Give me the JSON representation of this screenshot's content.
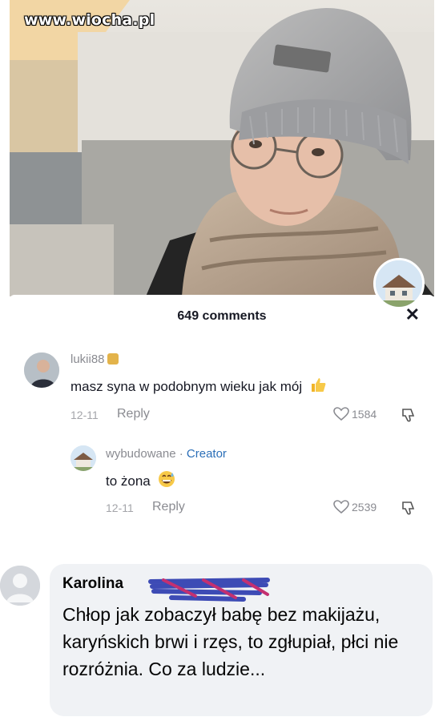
{
  "watermark": "www.wiocha.pl",
  "comments_panel": {
    "header": "649 comments",
    "close_icon": "close-icon"
  },
  "comments": [
    {
      "username": "lukii88",
      "text": "masz syna w podobnym wieku jak mój",
      "emoji": "thumbs-up-icon",
      "date": "12-11",
      "reply_label": "Reply",
      "likes": "1584"
    }
  ],
  "reply": {
    "username": "wybudowane",
    "separator": "·",
    "creator_label": "Creator",
    "text": "to żona",
    "emoji": "grinning-sweat-icon",
    "date": "12-11",
    "reply_label": "Reply",
    "likes": "2539"
  },
  "facebook_comment": {
    "name": "Karolina",
    "text": "Chłop jak zobaczył babę bez makijażu, karyńskich brwi i rzęs, to zgłupiał, płci nie rozróżnia. Co za ludzie..."
  },
  "colors": {
    "creator": "#2b6fb8",
    "text_dark": "#161823",
    "muted": "#8a8b91",
    "fb_bubble": "#f0f2f5"
  }
}
